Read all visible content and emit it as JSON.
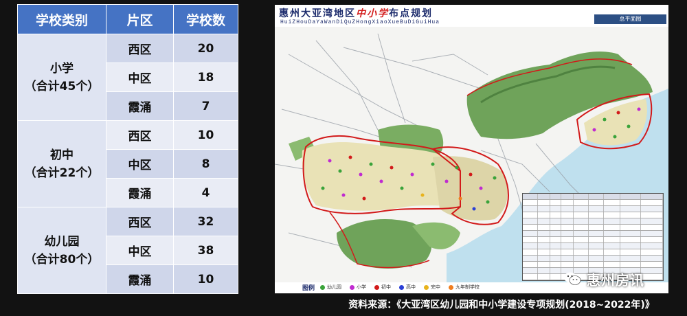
{
  "table": {
    "headers": [
      "学校类别",
      "片区",
      "学校数"
    ],
    "groups": [
      {
        "category": "小学",
        "total": "（合计45个）",
        "rows": [
          {
            "district": "西区",
            "count": "20"
          },
          {
            "district": "中区",
            "count": "18"
          },
          {
            "district": "霞涌",
            "count": "7"
          }
        ]
      },
      {
        "category": "初中",
        "total": "（合计22个）",
        "rows": [
          {
            "district": "西区",
            "count": "10"
          },
          {
            "district": "中区",
            "count": "8"
          },
          {
            "district": "霞涌",
            "count": "4"
          }
        ]
      },
      {
        "category": "幼儿园",
        "total": "（合计80个）",
        "rows": [
          {
            "district": "西区",
            "count": "32"
          },
          {
            "district": "中区",
            "count": "38"
          },
          {
            "district": "霞涌",
            "count": "10"
          }
        ]
      }
    ]
  },
  "map": {
    "title_left": "惠州大亚湾地区",
    "title_red": "中小学",
    "title_right": "布点规划",
    "subtitle": "HuiZHouDaYaWanDiQuZHongXiaoXueBuDiGuiHua",
    "tag": "总平面图",
    "legend_title": "图例",
    "legend": [
      {
        "label": "幼儿园",
        "color": "#3aa33a"
      },
      {
        "label": "小学",
        "color": "#c02bd0"
      },
      {
        "label": "初中",
        "color": "#d21a1a"
      },
      {
        "label": "高中",
        "color": "#2a3fd6"
      },
      {
        "label": "完中",
        "color": "#e8b31c"
      },
      {
        "label": "九年制学校",
        "color": "#f07d1e"
      }
    ]
  },
  "watermark": "惠州房讯",
  "source": "资料来源：《大亚湾区幼儿园和中小学建设专项规划(2018~2022年)》"
}
